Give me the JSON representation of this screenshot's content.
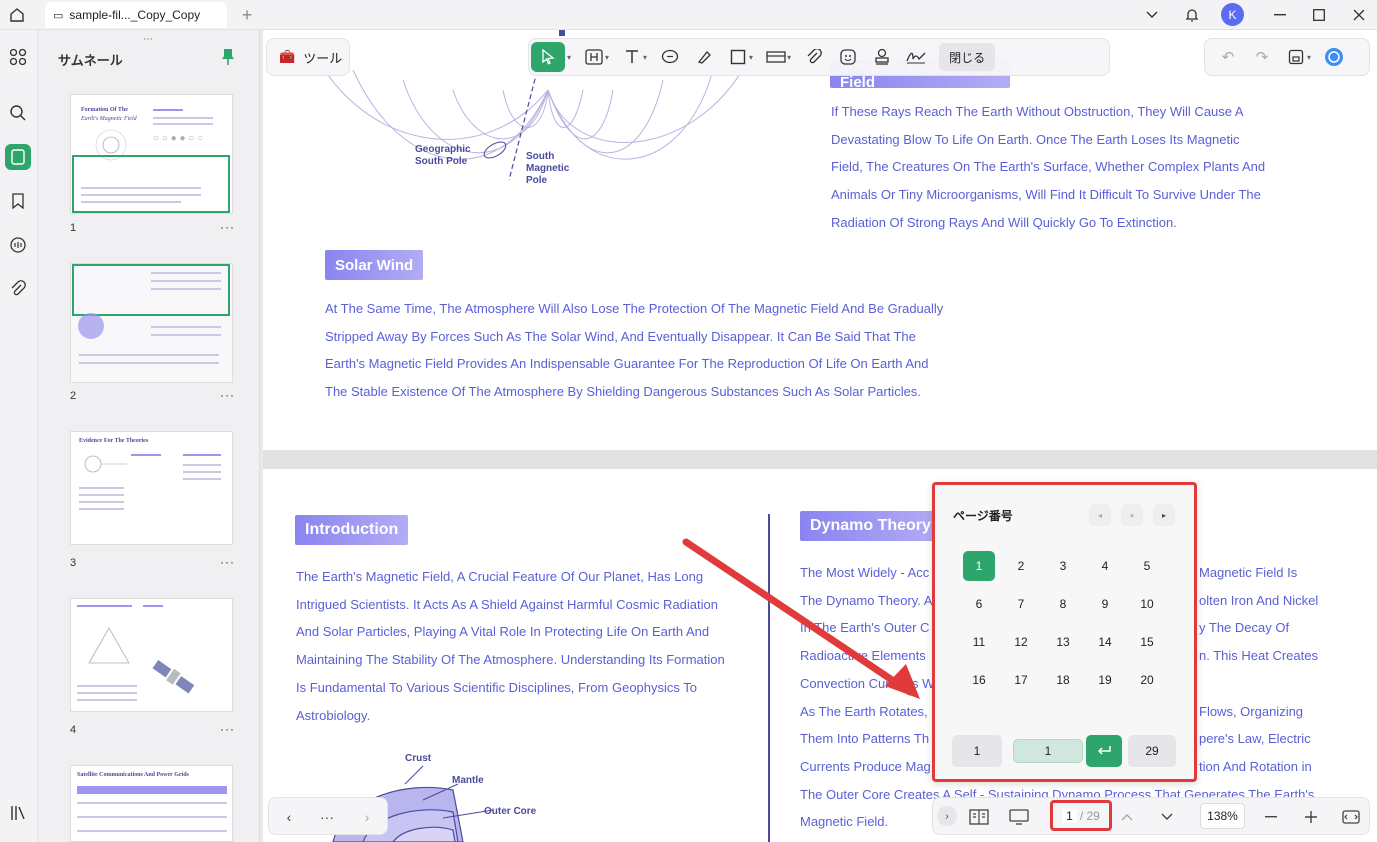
{
  "titlebar": {
    "tab_label": "sample-fil..._Copy_Copy",
    "new_tab": "+",
    "avatar_letter": "K"
  },
  "sidebar": {
    "title": "サムネール",
    "pages": [
      "1",
      "2",
      "3",
      "4"
    ],
    "more": "···"
  },
  "thumbs": {
    "t1_title": "Formation Of The",
    "t1_sub": "Earth's Magnetic Field",
    "t3_title": "Evidence For The Theories",
    "t5_title": "Satellite Communications And Power Grids"
  },
  "toolbar": {
    "tools_label": "ツール",
    "close_label": "閉じる"
  },
  "doc": {
    "geo_label_1": "Geographic",
    "geo_label_2": "South Pole",
    "mag_label_1": "South",
    "mag_label_2": "Magnetic",
    "mag_label_3": "Pole",
    "top_heading_fragment": "Loses Its Magnetic Field",
    "right_para": [
      "If These Rays Reach The Earth Without Obstruction, They Will Cause A",
      "Devastating Blow To Life On Earth. Once The Earth Loses Its Magnetic",
      "Field, The Creatures On The Earth's Surface, Whether Complex Plants And",
      "Animals Or Tiny Microorganisms, Will Find It Difficult To Survive Under The",
      "Radiation Of Strong Rays And Will Quickly Go To Extinction."
    ],
    "solar_heading": "Solar Wind",
    "solar_para": [
      "At The Same Time, The Atmosphere Will Also Lose The Protection Of The Magnetic Field And Be Gradually",
      "Stripped Away By Forces Such As The Solar Wind, And Eventually Disappear. It Can Be Said That The",
      "Earth's Magnetic Field Provides An Indispensable Guarantee For The Reproduction Of Life On Earth And",
      "The Stable Existence Of The Atmosphere By Shielding Dangerous Substances Such As Solar Particles."
    ],
    "intro_heading": "Introduction",
    "intro_para": [
      "The Earth's Magnetic Field, A Crucial Feature Of Our Planet, Has Long",
      "Intrigued Scientists. It Acts As A Shield Against Harmful Cosmic Radiation",
      "And Solar Particles, Playing A Vital Role In Protecting Life On Earth And",
      "Maintaining The Stability Of The Atmosphere. Understanding Its Formation",
      "Is Fundamental To Various Scientific Disciplines, From Geophysics To",
      "Astrobiology."
    ],
    "crust": "Crust",
    "mantle": "Mantle",
    "outer_core": "Outer Core",
    "dynamo_heading": "Dynamo Theory",
    "dynamo_left": [
      "The Most Widely - Acc",
      "The Dynamo Theory. A",
      "In The Earth's Outer C",
      "Radioactive Elements",
      "Convection Currents W",
      "As The Earth Rotates,",
      "Them Into Patterns Th",
      "Currents Produce Mag",
      "The Outer Core Creates A Self - Sustaining Dynamo Process That Generates The Earth's",
      "Magnetic Field."
    ],
    "dynamo_right": [
      "Magnetic Field Is",
      "olten Iron And Nickel",
      "y The Decay Of",
      "n. This Heat Creates",
      "",
      "Flows, Organizing",
      "pere's Law, Electric",
      "tion And Rotation in"
    ]
  },
  "popup": {
    "title": "ページ番号",
    "pages": [
      "1",
      "2",
      "3",
      "4",
      "5",
      "6",
      "7",
      "8",
      "9",
      "10",
      "11",
      "12",
      "13",
      "14",
      "15",
      "16",
      "17",
      "18",
      "19",
      "20"
    ],
    "first": "1",
    "input_value": "1",
    "last": "29"
  },
  "bottombar": {
    "current_page": "1",
    "total": "/ 29",
    "zoom": "138%"
  },
  "navbar": {
    "more": "···"
  },
  "colors": {
    "accent": "#2ea56a",
    "highlight": "#e03a3a",
    "doc_text": "#5a5fd6"
  }
}
